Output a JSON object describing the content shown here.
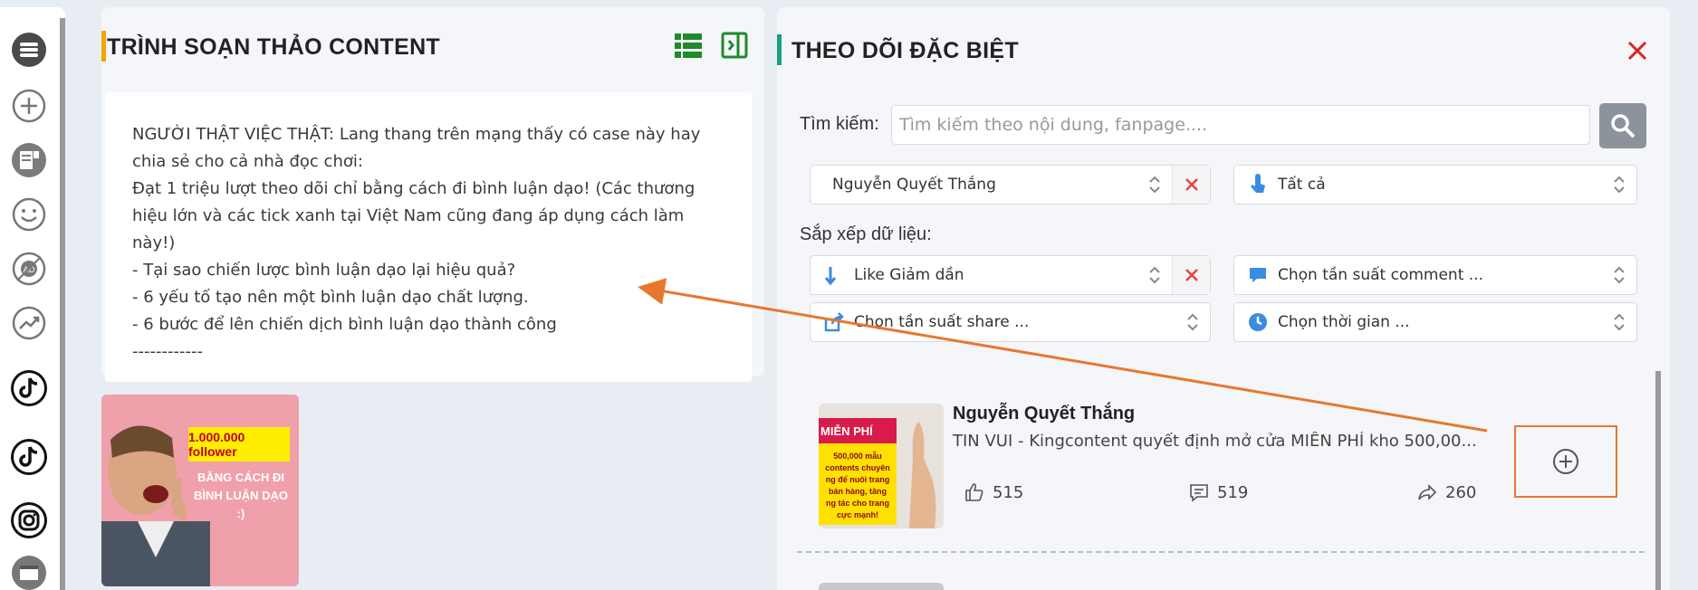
{
  "sidebar": {
    "icons": [
      "list-icon",
      "plus-circle-icon",
      "content-icon",
      "smile-icon",
      "ads-icon",
      "trend-icon",
      "tiktok-icon",
      "tiktok-alt-icon",
      "instagram-icon",
      "calendar-icon"
    ]
  },
  "editor": {
    "title": "TRÌNH SOẠN THẢO CONTENT",
    "accent": "#f0a500",
    "lines": [
      "NGƯỜI THẬT VIỆC THẬT: Lang thang trên mạng thấy có case này hay",
      "chia sẻ cho cả nhà đọc chơi:",
      "Đạt 1 triệu lượt theo dõi chỉ bằng cách đi bình luận dạo! (Các thương",
      "hiệu lớn và các tick xanh tại Việt Nam cũng đang áp dụng cách làm",
      "này!)",
      "- Tại sao chiến lược bình luận dạo lại hiệu quả?",
      "- 6 yếu tố tạo nên một bình luận dạo chất lượng.",
      "- 6 bước để lên chiến dịch bình luận dạo thành công",
      "------------"
    ],
    "image_caption_top": "1.000.000 follower",
    "image_caption_bottom": [
      "BẰNG CÁCH ĐI",
      "BÌNH LUẬN DẠO :)"
    ]
  },
  "follow": {
    "title": "THEO DÕI ĐẶC BIỆT",
    "accent": "#1aa07a",
    "search_label": "Tìm kiếm:",
    "search_placeholder": "Tìm kiếm theo nội dung, fanpage....",
    "filter_author": "Nguyễn Quyết Thắng",
    "filter_type": "Tất cả",
    "sort_label": "Sắp xếp dữ liệu:",
    "sort_like": "Like Giảm dần",
    "sort_comment": "Chọn tần suất comment ...",
    "sort_share": "Chọn tần suất share ...",
    "sort_time": "Chọn thời gian ..."
  },
  "post": {
    "author": "Nguyễn Quyết Thắng",
    "text": "TIN VUI - Kingcontent quyết định mở cửa MIỄN PHÍ kho 500,00...",
    "likes": "515",
    "comments": "519",
    "shares": "260",
    "thumb_badge": "MIỄN PHÍ",
    "thumb_lines": [
      "500,000 mẫu",
      "contents chuyên",
      "ng để nuôi trang",
      "bán hàng, tăng",
      "ng tác cho trang",
      "cực mạnh!"
    ]
  },
  "annotation": {
    "color": "#e8772e"
  }
}
